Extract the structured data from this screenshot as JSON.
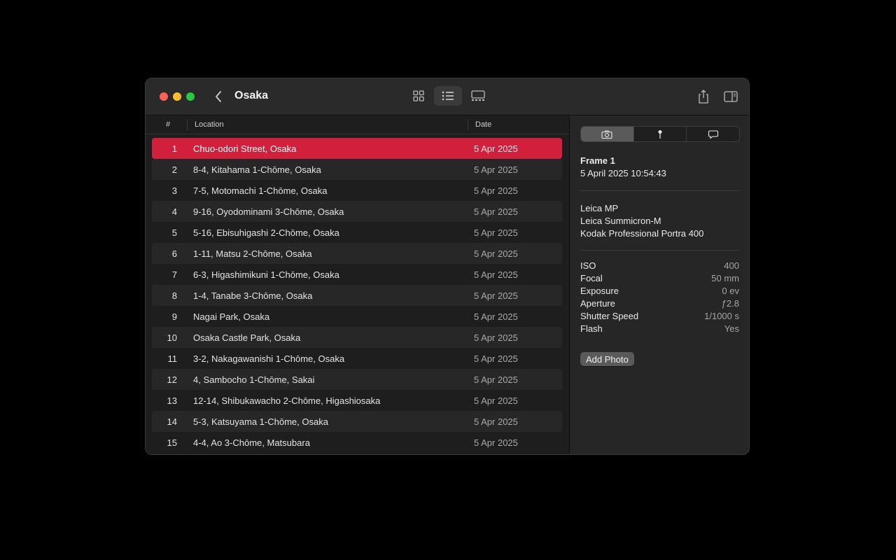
{
  "window": {
    "title": "Osaka"
  },
  "toolbar": {
    "back_icon": "chevron-left-icon",
    "view_modes": [
      "grid-view",
      "list-view",
      "gallery-view"
    ],
    "active_view": "list-view"
  },
  "list": {
    "headers": {
      "num": "#",
      "location": "Location",
      "date": "Date"
    },
    "selected_index": 0,
    "rows": [
      {
        "num": "1",
        "location": "Chuo-odori Street, Osaka",
        "date": "5 Apr 2025"
      },
      {
        "num": "2",
        "location": "8-4, Kitahama 1-Chōme, Osaka",
        "date": "5 Apr 2025"
      },
      {
        "num": "3",
        "location": "7-5, Motomachi 1-Chōme, Osaka",
        "date": "5 Apr 2025"
      },
      {
        "num": "4",
        "location": "9-16, Oyodominami 3-Chōme, Osaka",
        "date": "5 Apr 2025"
      },
      {
        "num": "5",
        "location": "5-16, Ebisuhigashi 2-Chōme, Osaka",
        "date": "5 Apr 2025"
      },
      {
        "num": "6",
        "location": "1-11, Matsu 2-Chōme, Osaka",
        "date": "5 Apr 2025"
      },
      {
        "num": "7",
        "location": "6-3, Higashimikuni 1-Chōme, Osaka",
        "date": "5 Apr 2025"
      },
      {
        "num": "8",
        "location": "1-4, Tanabe 3-Chōme, Osaka",
        "date": "5 Apr 2025"
      },
      {
        "num": "9",
        "location": "Nagai Park, Osaka",
        "date": "5 Apr 2025"
      },
      {
        "num": "10",
        "location": "Osaka Castle Park, Osaka",
        "date": "5 Apr 2025"
      },
      {
        "num": "11",
        "location": "3-2, Nakagawanishi 1-Chōme, Osaka",
        "date": "5 Apr 2025"
      },
      {
        "num": "12",
        "location": "4, Sambocho 1-Chōme, Sakai",
        "date": "5 Apr 2025"
      },
      {
        "num": "13",
        "location": "12-14, Shibukawacho 2-Chōme, Higashiosaka",
        "date": "5 Apr 2025"
      },
      {
        "num": "14",
        "location": "5-3, Katsuyama 1-Chōme, Osaka",
        "date": "5 Apr 2025"
      },
      {
        "num": "15",
        "location": "4-4, Ao 3-Chōme, Matsubara",
        "date": "5 Apr 2025"
      }
    ]
  },
  "inspector": {
    "tabs": [
      "camera-tab",
      "location-tab",
      "comment-tab"
    ],
    "active_tab": "camera-tab",
    "frame_title": "Frame 1",
    "frame_date": "5 April 2025  10:54:43",
    "camera": "Leica MP",
    "lens": "Leica Summicron-M",
    "film": "Kodak Professional Portra 400",
    "exif": [
      {
        "key": "ISO",
        "value": "400"
      },
      {
        "key": "Focal",
        "value": "50 mm"
      },
      {
        "key": "Exposure",
        "value": "0 ev"
      },
      {
        "key": "Aperture",
        "value": "ƒ2.8"
      },
      {
        "key": "Shutter Speed",
        "value": "1/1000 s"
      },
      {
        "key": "Flash",
        "value": "Yes"
      }
    ],
    "add_photo_label": "Add Photo"
  },
  "colors": {
    "accent_selection": "#d21f3c",
    "close": "#ff5f57",
    "minimize": "#febc2e",
    "maximize": "#28c840"
  }
}
